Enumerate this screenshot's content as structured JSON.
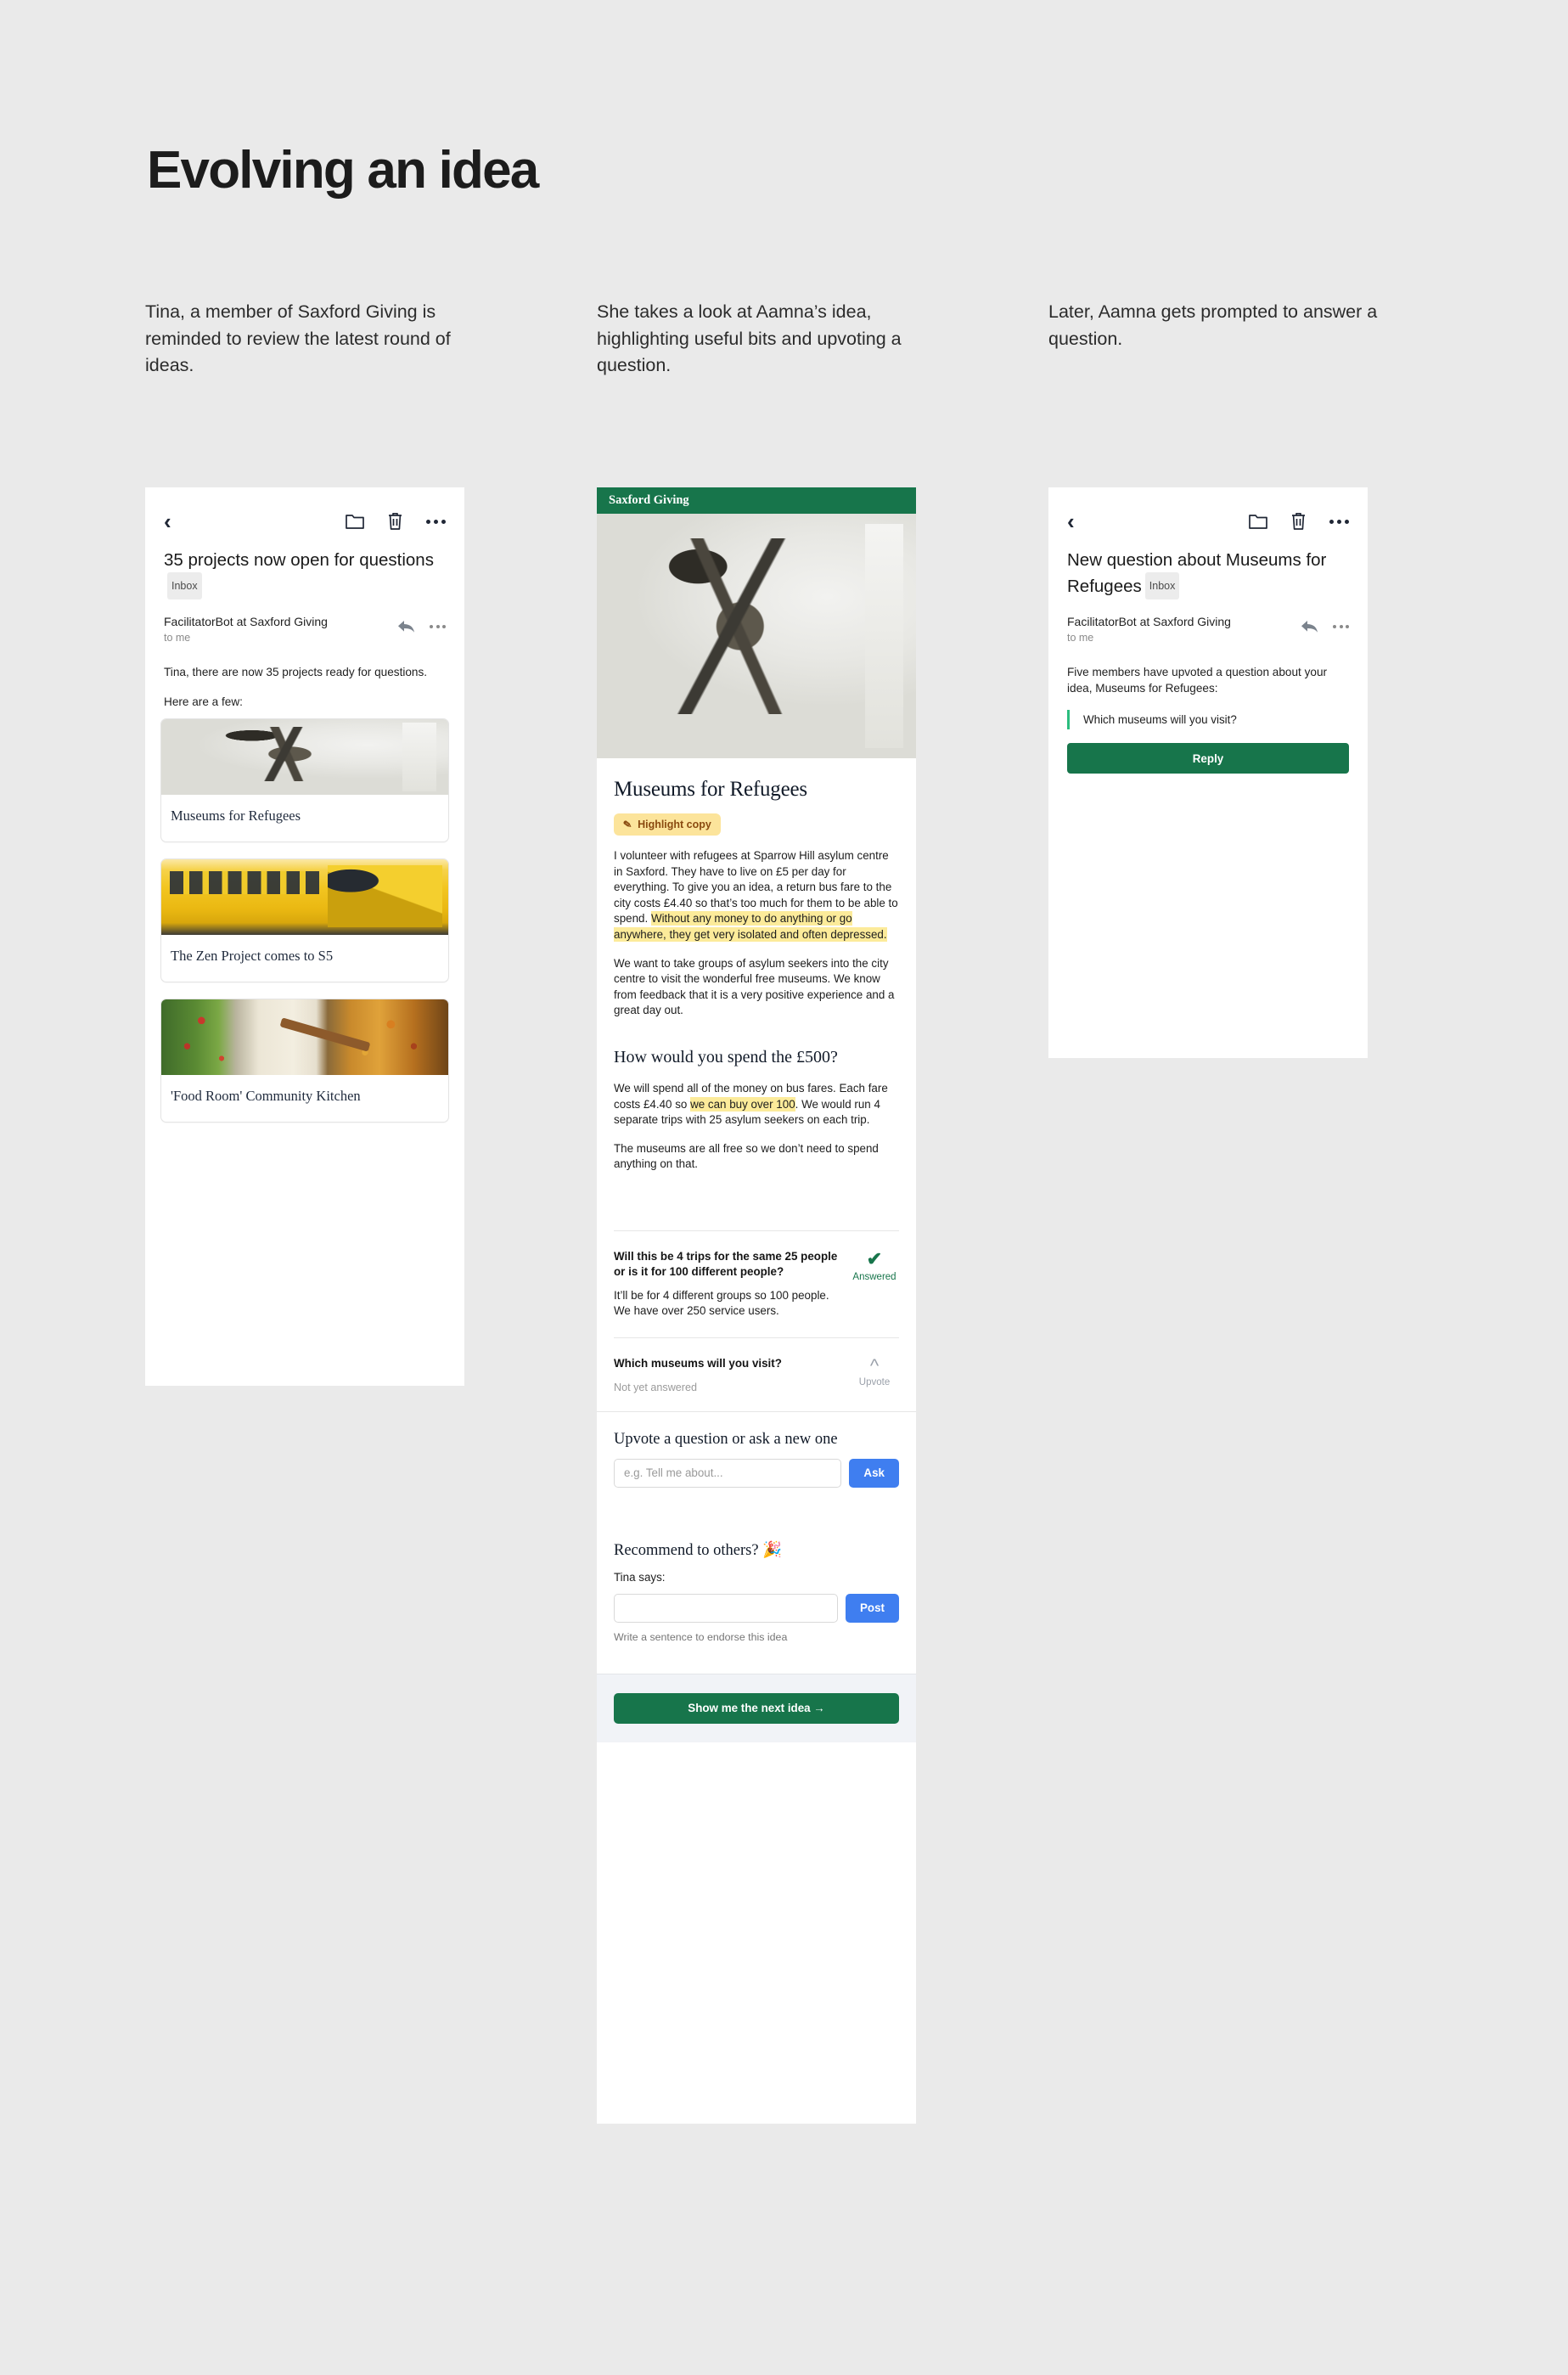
{
  "page": {
    "title": "Evolving an idea",
    "background_color": "#eaeaea"
  },
  "colors": {
    "brand_green": "#17754b",
    "accent_blue": "#3f7ef0",
    "highlight_yellow": "#fceb9a",
    "quote_green": "#2bbd7e",
    "chip_yellow": "#fce49b",
    "chip_text": "#8a4a10"
  },
  "captions": [
    "Tina, a member of Saxford Giving is reminded to review the latest round of ideas.",
    "She takes a look at Aamna’s idea, highlighting useful bits and upvoting a question.",
    "Later, Aamna gets prompted to answer a question."
  ],
  "panel1": {
    "toolbar": {
      "back": "‹",
      "folder_icon": "folder-icon",
      "trash_icon": "trash-icon",
      "more_icon": "more-icon"
    },
    "subject": "35 projects now open for questions",
    "label": "Inbox",
    "sender": "FacilitatorBot at Saxford Giving",
    "recipient": "to me",
    "body": [
      "Tina, there are now 35 projects ready for questions.",
      "Here are a few:"
    ],
    "cards": [
      {
        "title": "Museums for Refugees",
        "art": "art-museum",
        "image_name": "dinosaur-skeleton-museum-photo"
      },
      {
        "title": "The Zen Project comes to S5",
        "art": "art-bus",
        "image_name": "yellow-school-bus-photo"
      },
      {
        "title": "'Food Room' Community Kitchen",
        "art": "art-food",
        "image_name": "community-kitchen-food-photo"
      }
    ]
  },
  "panel2": {
    "app_bar_title": "Saxford Giving",
    "hero_image_name": "dinosaur-skeleton-museum-photo",
    "idea_title": "Museums for Refugees",
    "highlight_chip": "Highlight copy",
    "paragraph_1_pre": "I volunteer with refugees at Sparrow Hill asylum centre in Saxford. They have to live on £5 per day for everything. To give you an idea, a return bus fare to the city costs £4.40 so that’s too much for them to be able to spend. ",
    "paragraph_1_mark": "Without any money to do anything or go anywhere, they get very isolated and often depressed.",
    "paragraph_2": "We want to take groups of asylum seekers into the city centre to visit the wonderful free museums. We know from feedback that it is a very positive experience and a great day out.",
    "section_heading": "How would you spend the £500?",
    "paragraph_3_pre": "We will spend all of the money on bus fares. Each fare costs £4.40 so ",
    "paragraph_3_mark": "we can buy over 100",
    "paragraph_3_post": ". We would run 4 separate trips with 25 asylum seekers on each trip.",
    "paragraph_4": "The museums are all free so we don’t need to spend anything on that.",
    "questions": [
      {
        "question": "Will this be 4 trips for the same 25 people or is it for 100 different people?",
        "answer": "It’ll be for 4 different groups so 100 people. We have over 250 service users.",
        "status_label": "Answered",
        "status_icon": "check-icon"
      },
      {
        "question": "Which museums will you visit?",
        "answer": "Not yet answered",
        "status_label": "Upvote",
        "status_icon": "chevron-up-icon"
      }
    ],
    "ask": {
      "heading": "Upvote a question or ask a new one",
      "placeholder": "e.g. Tell me about...",
      "value": "",
      "button": "Ask"
    },
    "recommend": {
      "heading": "Recommend to others? 🎉",
      "label": "Tina says:",
      "placeholder": "",
      "value": "",
      "button": "Post",
      "hint": "Write a sentence to endorse this idea"
    },
    "footer_button": "Show me the next idea  →"
  },
  "panel3": {
    "toolbar": {
      "back": "‹",
      "folder_icon": "folder-icon",
      "trash_icon": "trash-icon",
      "more_icon": "more-icon"
    },
    "subject": "New question about Museums for Refugees",
    "label": "Inbox",
    "sender": "FacilitatorBot at Saxford Giving",
    "recipient": "to me",
    "body": "Five members have upvoted a question about your idea, Museums for Refugees:",
    "quote": "Which museums will you visit?",
    "reply_button": "Reply"
  }
}
